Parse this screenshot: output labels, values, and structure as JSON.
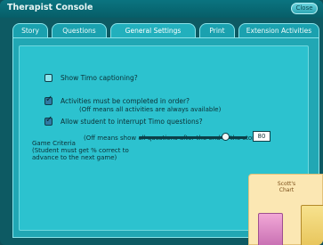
{
  "window": {
    "title": "Therapist Console",
    "close_label": "Close"
  },
  "tabs": [
    {
      "label": "Story",
      "active": false
    },
    {
      "label": "Questions",
      "active": false
    },
    {
      "label": "General Settings",
      "active": true
    },
    {
      "label": "Print",
      "active": false
    },
    {
      "label": "Extension Activities",
      "active": false
    }
  ],
  "settings": {
    "show_captioning": {
      "label": "Show Timo captioning?",
      "checked": false
    },
    "activities_in_order": {
      "label": "Activities must be completed in order?",
      "note": "(Off means all activities are always available)",
      "checked": true
    },
    "allow_interrupt": {
      "label": "Allow student to interrupt Timo questions?",
      "note": "(Off means show all questions after the end of the story)",
      "checked": true
    }
  },
  "game_criteria": {
    "label_line1": "Game Criteria",
    "label_line2": "(Student must get % correct to",
    "label_line3": "advance to the next game)",
    "value": "80",
    "slider_fraction": 0.8
  },
  "chart_card": {
    "title_line1": "Scott's",
    "title_line2": "Chart"
  },
  "colors": {
    "window_bg": "#0d5a63",
    "panel_bg": "#21a7b4",
    "content_bg": "#2cc2cf"
  }
}
